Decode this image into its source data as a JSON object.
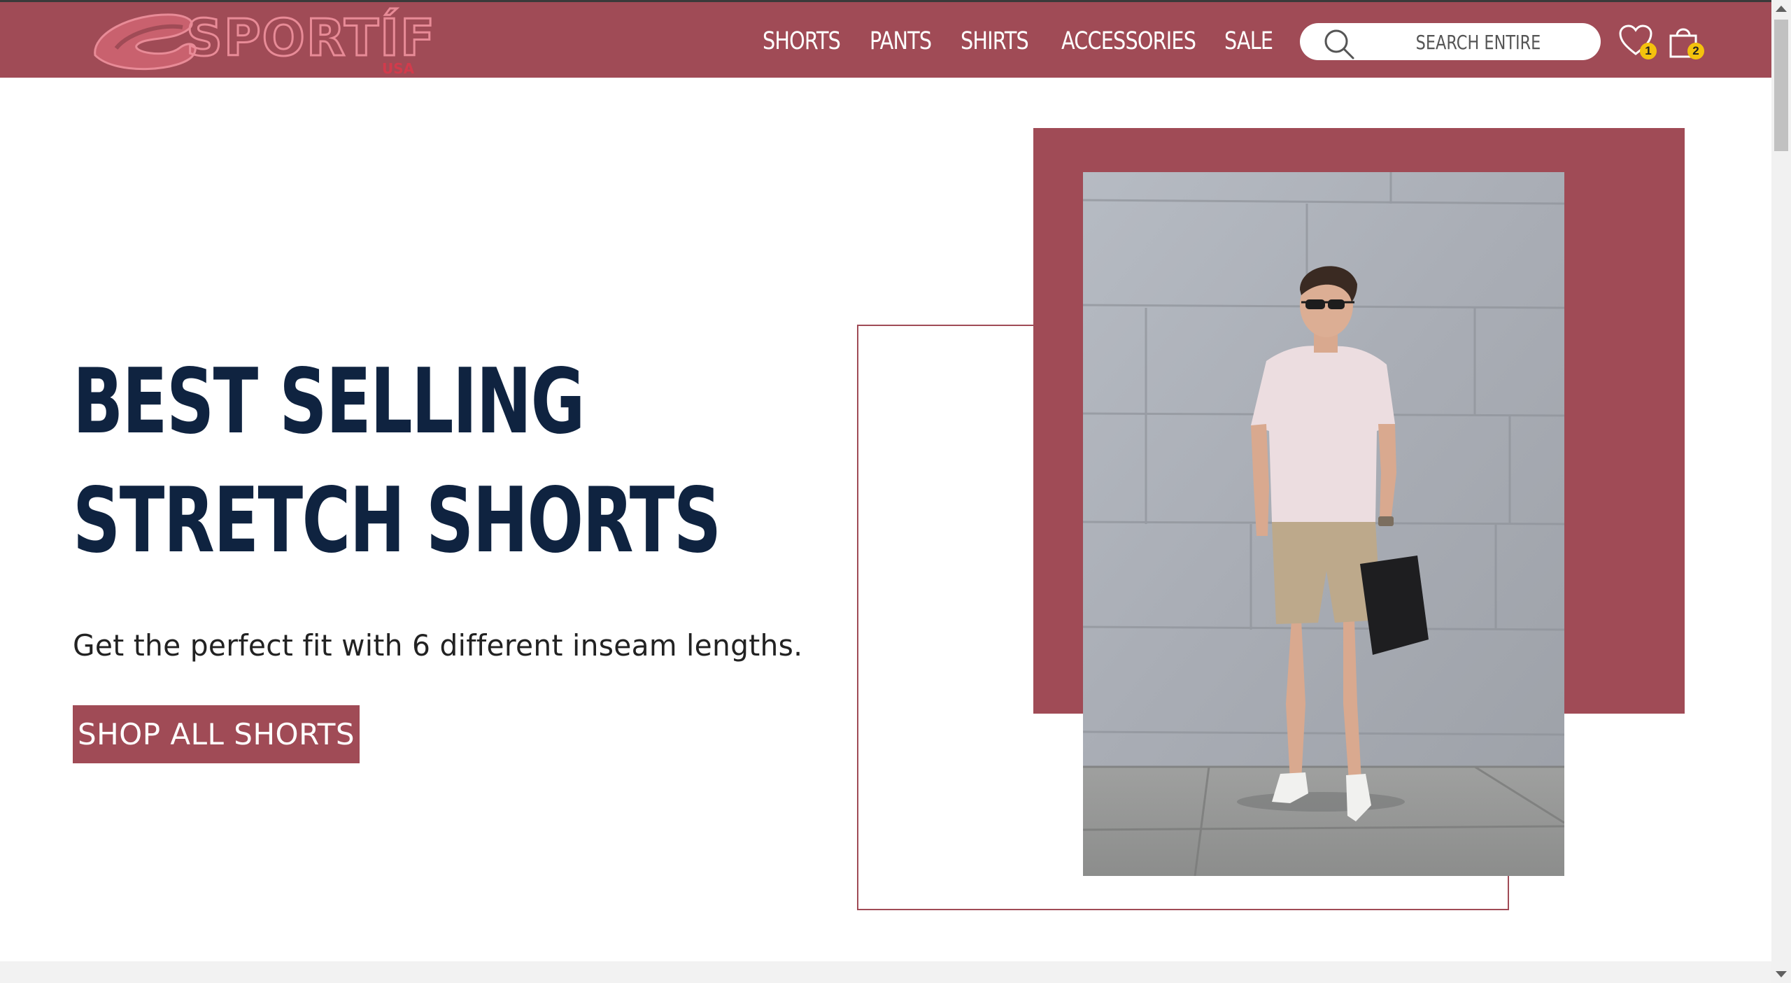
{
  "brand": {
    "logo_text": "SPORTÍF",
    "logo_subtext": "USA",
    "primary_color": "#a04b56",
    "heading_color": "#0f2340"
  },
  "nav": {
    "items": [
      {
        "label": "SHORTS"
      },
      {
        "label": "PANTS"
      },
      {
        "label": "SHIRTS"
      },
      {
        "label": "ACCESSORIES"
      },
      {
        "label": "SALE"
      }
    ]
  },
  "search": {
    "placeholder": "SEARCH ENTIRE",
    "icon": "search-icon"
  },
  "header_icons": {
    "wishlist": {
      "icon": "heart-icon",
      "count": "1"
    },
    "cart": {
      "icon": "shopping-bag-icon",
      "count": "2"
    }
  },
  "hero": {
    "title_line1": "BEST SELLING",
    "title_line2": "STRETCH SHORTS",
    "subtitle": "Get the perfect fit with 6 different inseam lengths.",
    "cta_label": "SHOP ALL SHORTS"
  }
}
